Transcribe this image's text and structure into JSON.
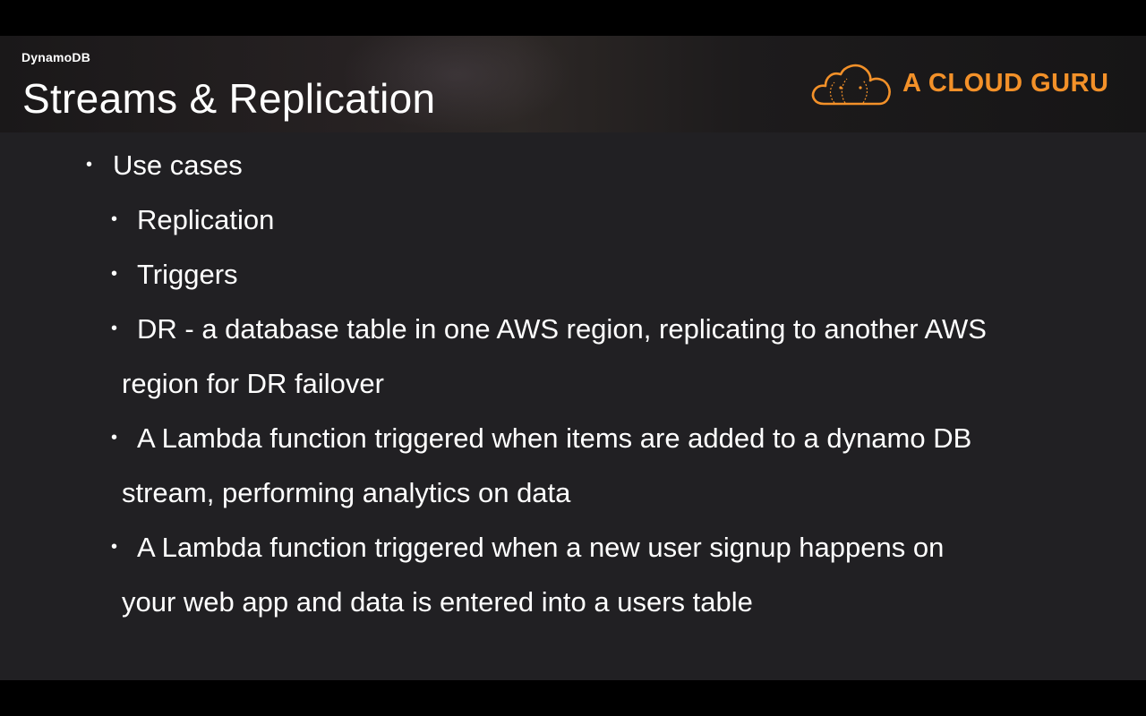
{
  "slide": {
    "category": "DynamoDB",
    "title": "Streams & Replication",
    "logo_text": "A CLOUD GURU",
    "brand_color": "#f39129",
    "background_color": "#212023",
    "bullets": {
      "top": "Use cases",
      "items": [
        "Replication",
        "Triggers"
      ],
      "dr": {
        "line1": "DR - a database table in one AWS region, replicating to another AWS",
        "line2": "region for DR failover"
      },
      "lambda1": {
        "line1": "A Lambda function triggered when items are added to a dynamo DB",
        "line2": "stream, performing analytics on data"
      },
      "lambda2": {
        "line1": "A Lambda function triggered when a new user signup happens on",
        "line2": "your web app and data is entered into a users table"
      }
    }
  }
}
